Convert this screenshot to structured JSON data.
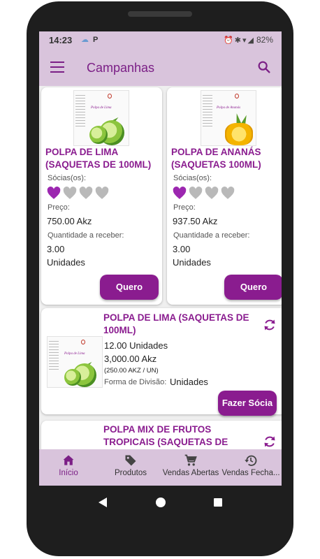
{
  "status_bar": {
    "time": "14:23",
    "app_letter": "P",
    "battery": "82%"
  },
  "app_bar": {
    "title": "Campanhas"
  },
  "colors": {
    "primary": "#8a1c8f",
    "appbar": "#d9c4dc",
    "heart_filled": "#9c27b0",
    "heart_empty": "#b9b9b9"
  },
  "grid_cards": [
    {
      "title_line1": "POLPA DE LIMA",
      "title_line2": "(SAQUETAS DE 100ML)",
      "package_label": "Polpa de Lima",
      "partners_label": "Sócias(os):",
      "partners_filled": 1,
      "partners_total": 4,
      "price_label": "Preço:",
      "price": "750.00 Akz",
      "qty_label": "Quantidade a receber:",
      "qty": "3.00",
      "unit": "Unidades",
      "button": "Quero"
    },
    {
      "title_line1": "POLPA DE ANANÁS",
      "title_line2": "(SAQUETAS 100ML)",
      "package_label": "Polpa de Ananás",
      "partners_label": "Sócias(os):",
      "partners_filled": 1,
      "partners_total": 4,
      "price_label": "Preço:",
      "price": "937.50 Akz",
      "qty_label": "Quantidade a receber:",
      "qty": "3.00",
      "unit": "Unidades",
      "button": "Quero"
    }
  ],
  "list_cards": [
    {
      "title_line1": "POLPA DE LIMA (SAQUETAS DE",
      "title_line2": "100ML)",
      "package_label": "Polpa de Lima",
      "quantity": "12.00 Unidades",
      "price": "3,000.00 Akz",
      "unit_price": "(250.00 AKZ / UN)",
      "division_label": "Forma de Divisão:",
      "division_value": "Unidades",
      "button": "Fazer Sócia"
    },
    {
      "title_line1": "POLPA MIX DE FRUTOS",
      "title_line2": "TROPICAIS (SAQUETAS DE"
    }
  ],
  "bottom_nav": [
    {
      "label": "Início",
      "icon": "home-icon",
      "active": true
    },
    {
      "label": "Produtos",
      "icon": "tag-icon",
      "active": false
    },
    {
      "label": "Vendas Abertas",
      "icon": "cart-icon",
      "active": false
    },
    {
      "label": "Vendas Fecha...",
      "icon": "history-icon",
      "active": false
    }
  ]
}
